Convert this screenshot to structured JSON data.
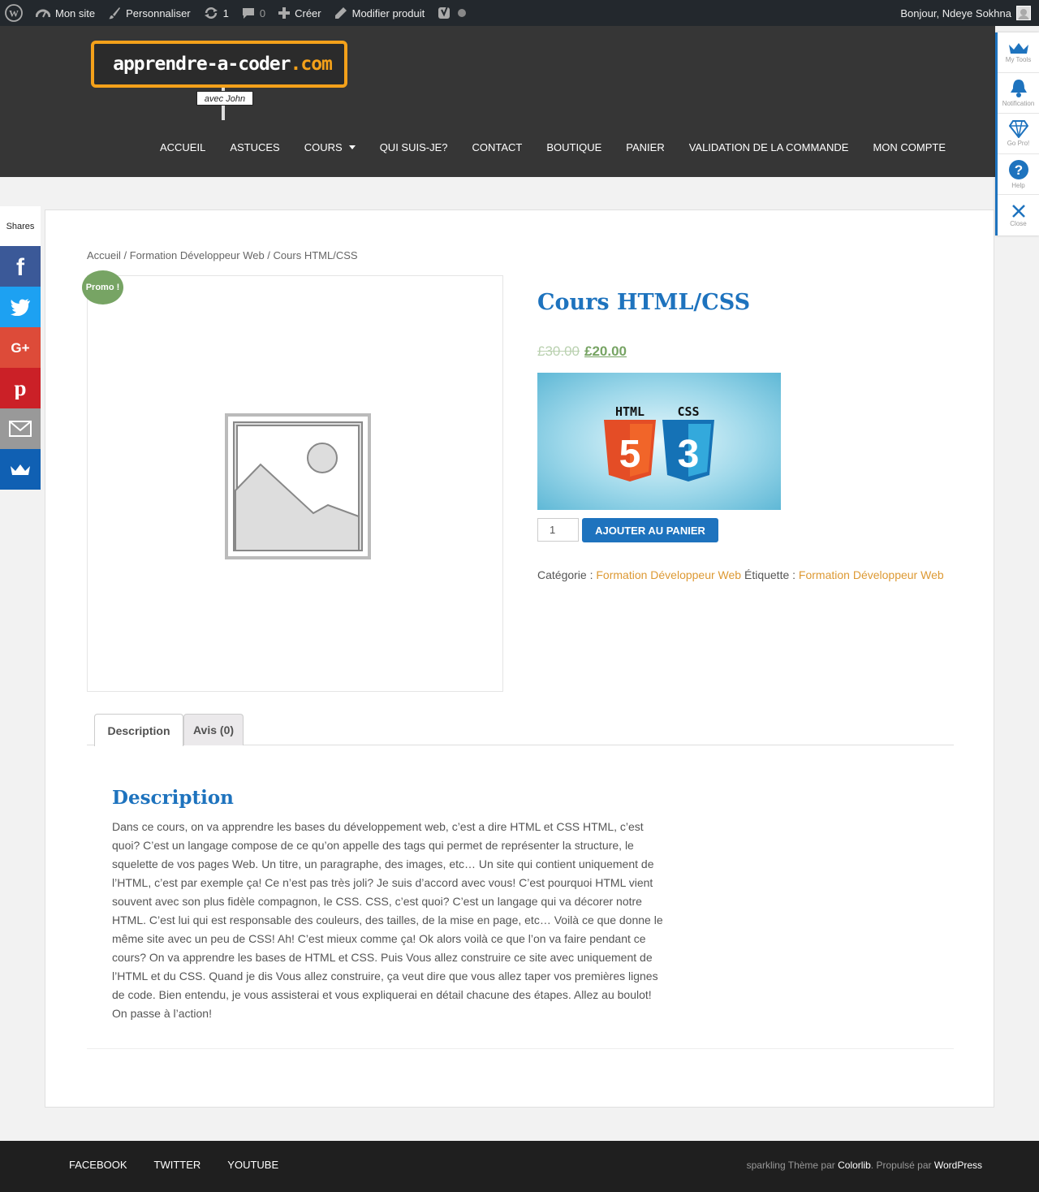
{
  "adminbar": {
    "site": "Mon site",
    "customize": "Personnaliser",
    "updates_count": "1",
    "comments_count": "0",
    "create": "Créer",
    "edit_product": "Modifier produit",
    "greeting": "Bonjour, Ndeye Sokhna"
  },
  "logo": {
    "main": "apprendre-a-coder",
    "tld": ".com",
    "sign": "avec John"
  },
  "nav": [
    "ACCUEIL",
    "ASTUCES",
    "COURS",
    "QUI SUIS-JE?",
    "CONTACT",
    "BOUTIQUE",
    "PANIER",
    "VALIDATION DE LA COMMANDE",
    "MON COMPTE"
  ],
  "tools": [
    "My Tools",
    "Notification",
    "Go Pro!",
    "Help",
    "Close"
  ],
  "shares_label": "Shares",
  "share_colors": {
    "facebook": "#3b5998",
    "twitter": "#1da1f2",
    "google": "#dd4b39",
    "pinterest": "#cb2027",
    "email": "#999999",
    "sumo": "#1060b3"
  },
  "breadcrumb": "Accueil / Formation Développeur Web / Cours HTML/CSS",
  "product": {
    "promo": "Promo !",
    "title": "Cours HTML/CSS",
    "old_price": "£30.00",
    "new_price": "£20.00",
    "banner_html": "HTML",
    "banner_css": "CSS",
    "quantity": "1",
    "add_to_cart": "AJOUTER AU PANIER",
    "category_label": "Catégorie :",
    "category": "Formation Développeur Web",
    "tag_label": "Étiquette :",
    "tag": "Formation Développeur Web"
  },
  "tabs": {
    "description": "Description",
    "reviews": "Avis (0)"
  },
  "description": {
    "heading": "Description",
    "text": "Dans ce cours, on va apprendre les bases du développement web, c’est a dire HTML et CSS HTML, c’est quoi? C’est un langage compose de ce qu’on appelle des tags qui permet de représenter la structure, le squelette de vos pages Web. Un titre, un paragraphe, des images, etc… Un site qui contient uniquement de l’HTML, c’est par exemple ça! Ce n’est pas très joli? Je suis d’accord avec vous! C’est pourquoi HTML vient souvent avec son plus fidèle compagnon, le CSS. CSS, c’est quoi? C’est un langage qui va décorer notre HTML. C’est lui qui est responsable des couleurs, des tailles, de la mise en page, etc… Voilà ce que donne le même site avec un peu de CSS! Ah! C’est mieux comme ça! Ok alors voilà ce que l’on va faire pendant ce cours? On va apprendre les bases de HTML et CSS. Puis Vous allez construire ce site avec uniquement de l’HTML et du CSS. Quand je dis Vous allez construire, ça veut dire que vous allez taper vos premières lignes de code. Bien entendu, je vous assisterai et vous expliquerai en détail chacune des étapes. Allez au boulot! On passe à l’action!"
  },
  "footer": {
    "links": [
      "FACEBOOK",
      "TWITTER",
      "YOUTUBE"
    ],
    "credit_prefix": "sparkling Thème par",
    "credit_link1": "Colorlib",
    "credit_mid": ". Propulsé par",
    "credit_link2": "WordPress"
  }
}
